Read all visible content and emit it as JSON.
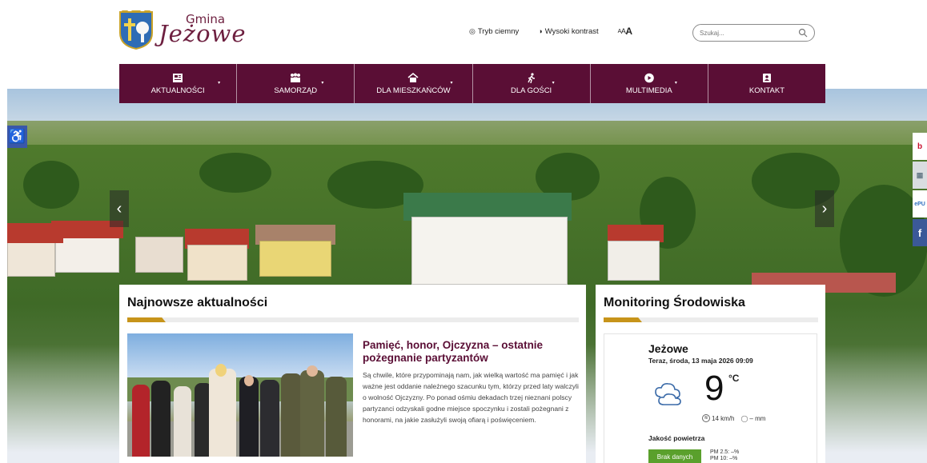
{
  "brand": {
    "small": "Gmina",
    "big": "Jeżowe"
  },
  "tools": {
    "dark_mode": "Tryb ciemny",
    "high_contrast": "Wysoki kontrast",
    "font_size_small": "A",
    "font_size_mid": "A",
    "font_size_big": "A"
  },
  "search": {
    "placeholder": "Szukaj..."
  },
  "nav": [
    {
      "label": "AKTUALNOŚCI",
      "icon": "newspaper-icon"
    },
    {
      "label": "SAMORZĄD",
      "icon": "people-icon"
    },
    {
      "label": "DLA MIESZKAŃCÓW",
      "icon": "home-icon"
    },
    {
      "label": "DLA GOŚCI",
      "icon": "walking-icon"
    },
    {
      "label": "MULTIMEDIA",
      "icon": "play-icon"
    },
    {
      "label": "KONTAKT",
      "icon": "contact-book-icon"
    }
  ],
  "hero": {
    "prev": "‹",
    "next": "›"
  },
  "social": {
    "item1": "b",
    "item3": "ePU",
    "item4": "f"
  },
  "news": {
    "heading": "Najnowsze aktualności",
    "article": {
      "title": "Pamięć, honor, Ojczyzna – ostatnie pożegnanie partyzantów",
      "text": "Są chwile, które przypominają nam, jak wielką wartość ma pamięć i jak ważne jest oddanie należnego szacunku tym, którzy przed laty walczyli o wolność Ojczyzny. Po ponad ośmiu dekadach trzej nieznani polscy partyzanci odzyskali godne miejsce spoczynku i zostali pożegnani z honorami, na jakie zasłużyli swoją ofiarą i poświęceniem."
    }
  },
  "monitoring": {
    "heading": "Monitoring Środowiska",
    "city": "Jeżowe",
    "now": "Teraz, środa, 13 maja 2026 09:09",
    "temperature": "9",
    "unit": "°C",
    "wind": "14 km/h",
    "rain": "– mm",
    "air_quality": "Jakość powietrza",
    "no_data": "Brak danych",
    "pm25": "PM 2.5: –%",
    "pm10": "PM 10: –%"
  },
  "colors": {
    "brand": "#5a0e35",
    "accent": "#c7941a",
    "ok": "#5aa02c"
  }
}
